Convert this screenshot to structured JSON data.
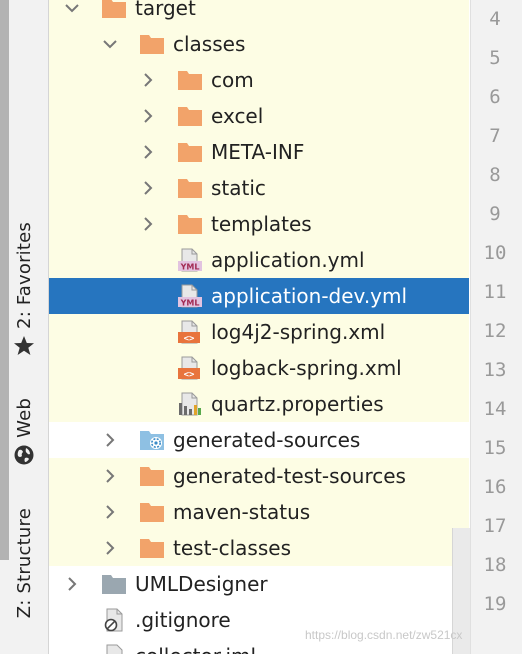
{
  "side_tabs": {
    "favorites": "2: Favorites",
    "web": "Web",
    "structure": "Z: Structure"
  },
  "tree": {
    "items": [
      {
        "label": "target",
        "icon": "folder-orange-icon"
      },
      {
        "label": "classes",
        "icon": "folder-orange-icon"
      },
      {
        "label": "com",
        "icon": "folder-orange-icon"
      },
      {
        "label": "excel",
        "icon": "folder-orange-icon"
      },
      {
        "label": "META-INF",
        "icon": "folder-orange-icon"
      },
      {
        "label": "static",
        "icon": "folder-orange-icon"
      },
      {
        "label": "templates",
        "icon": "folder-orange-icon"
      },
      {
        "label": "application.yml",
        "icon": "yml-file-icon"
      },
      {
        "label": "application-dev.yml",
        "icon": "yml-file-icon",
        "selected": true
      },
      {
        "label": "log4j2-spring.xml",
        "icon": "xml-file-icon"
      },
      {
        "label": "logback-spring.xml",
        "icon": "xml-file-icon"
      },
      {
        "label": "quartz.properties",
        "icon": "properties-file-icon"
      },
      {
        "label": "generated-sources",
        "icon": "source-folder-icon"
      },
      {
        "label": "generated-test-sources",
        "icon": "folder-orange-icon"
      },
      {
        "label": "maven-status",
        "icon": "folder-orange-icon"
      },
      {
        "label": "test-classes",
        "icon": "folder-orange-icon"
      },
      {
        "label": "UMLDesigner",
        "icon": "folder-gray-icon"
      },
      {
        "label": ".gitignore",
        "icon": "gitignore-file-icon"
      },
      {
        "label": "collector.iml",
        "icon": "iml-file-icon"
      }
    ]
  },
  "gutter": {
    "line_numbers": [
      "4",
      "5",
      "6",
      "7",
      "8",
      "9",
      "10",
      "11",
      "12",
      "13",
      "14",
      "15",
      "16",
      "17",
      "18",
      "19"
    ]
  },
  "watermark": "https://blog.csdn.net/zw521cx",
  "colors": {
    "tree_background": "#fdfde4",
    "selection": "#2675bf",
    "folder": "#f2a36a",
    "gray_folder": "#9aa7b0"
  }
}
